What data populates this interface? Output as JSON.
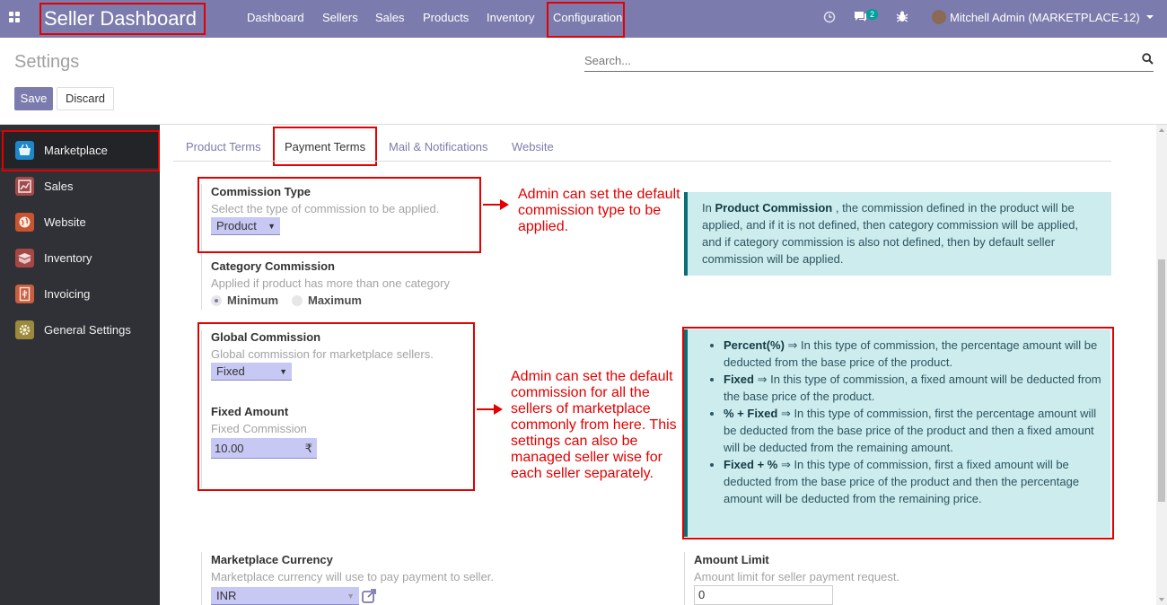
{
  "navbar": {
    "brand": "Seller Dashboard",
    "menu": [
      "Dashboard",
      "Sellers",
      "Sales",
      "Products",
      "Inventory",
      "Configuration"
    ],
    "chat_count": "2",
    "user": "Mitchell Admin (MARKETPLACE-12)",
    "icons": [
      "apps-icon",
      "clock-icon",
      "chat-icon",
      "bug-icon",
      "avatar",
      "caret-down-icon"
    ]
  },
  "control_panel": {
    "title": "Settings",
    "search_placeholder": "Search...",
    "save_label": "Save",
    "discard_label": "Discard"
  },
  "sidebar": {
    "items": [
      {
        "label": "Marketplace",
        "icon": "marketplace-icon",
        "color": "#1e87c9"
      },
      {
        "label": "Sales",
        "icon": "sales-icon",
        "color": "#a34b4b"
      },
      {
        "label": "Website",
        "icon": "website-icon",
        "color": "#c9542f"
      },
      {
        "label": "Inventory",
        "icon": "inventory-icon",
        "color": "#a54745"
      },
      {
        "label": "Invoicing",
        "icon": "invoicing-icon",
        "color": "#c95f3f"
      },
      {
        "label": "General Settings",
        "icon": "gear-icon",
        "color": "#9b8a3b"
      }
    ]
  },
  "tabs": [
    "Product Terms",
    "Payment Terms",
    "Mail & Notifications",
    "Website"
  ],
  "commission_type": {
    "title": "Commission Type",
    "help": "Select the type of commission to be applied.",
    "value": "Product"
  },
  "category_commission": {
    "title": "Category Commission",
    "help": "Applied if product has more than one category",
    "options": [
      "Minimum",
      "Maximum"
    ],
    "selected": "Minimum"
  },
  "global_commission": {
    "title": "Global Commission",
    "help": "Global commission for marketplace sellers.",
    "value": "Fixed"
  },
  "fixed_amount": {
    "title": "Fixed Amount",
    "help": "Fixed Commission",
    "value": "10.00",
    "currency": "₹"
  },
  "marketplace_currency": {
    "title": "Marketplace Currency",
    "help": "Marketplace currency will use to pay payment to seller.",
    "value": "INR"
  },
  "amount_limit": {
    "title": "Amount Limit",
    "help": "Amount limit for seller payment request.",
    "value": "0"
  },
  "annotations": {
    "commission_type": "Admin can set the default commission type to be applied.",
    "global_commission": "Admin can set the default commission for all the sellers of marketplace commonly from here. This settings can also be managed seller wise for each seller separately."
  },
  "info_product_commission": {
    "prefix": "In",
    "bold": "Product Commission",
    "text": ", the commission defined in the product will be applied, and if it is not defined, then category commission will be applied, and if category commission is also not defined, then by default seller commission will be applied."
  },
  "info_commission_types": [
    {
      "bold": "Percent(%)",
      "text": " ⇒ In this type of commission, the percentage amount will be deducted from the base price of the product."
    },
    {
      "bold": "Fixed",
      "text": " ⇒ In this type of commission, a fixed amount will be deducted from the base price of the product."
    },
    {
      "bold": "% + Fixed",
      "text": " ⇒ In this type of commission, first the percentage amount will be deducted from the base price of the product and then a fixed amount will be deducted from the remaining amount."
    },
    {
      "bold": "Fixed + %",
      "text": " ⇒ In this type of commission, first a fixed amount will be deducted from the base price of the product and then the percentage amount will be deducted from the remaining price."
    }
  ],
  "colors": {
    "navbar": "#7c7bad",
    "sidebar": "#2f3136",
    "highlight": "#e30000",
    "info_bg": "#cdecee",
    "info_border": "#0b6e75"
  }
}
